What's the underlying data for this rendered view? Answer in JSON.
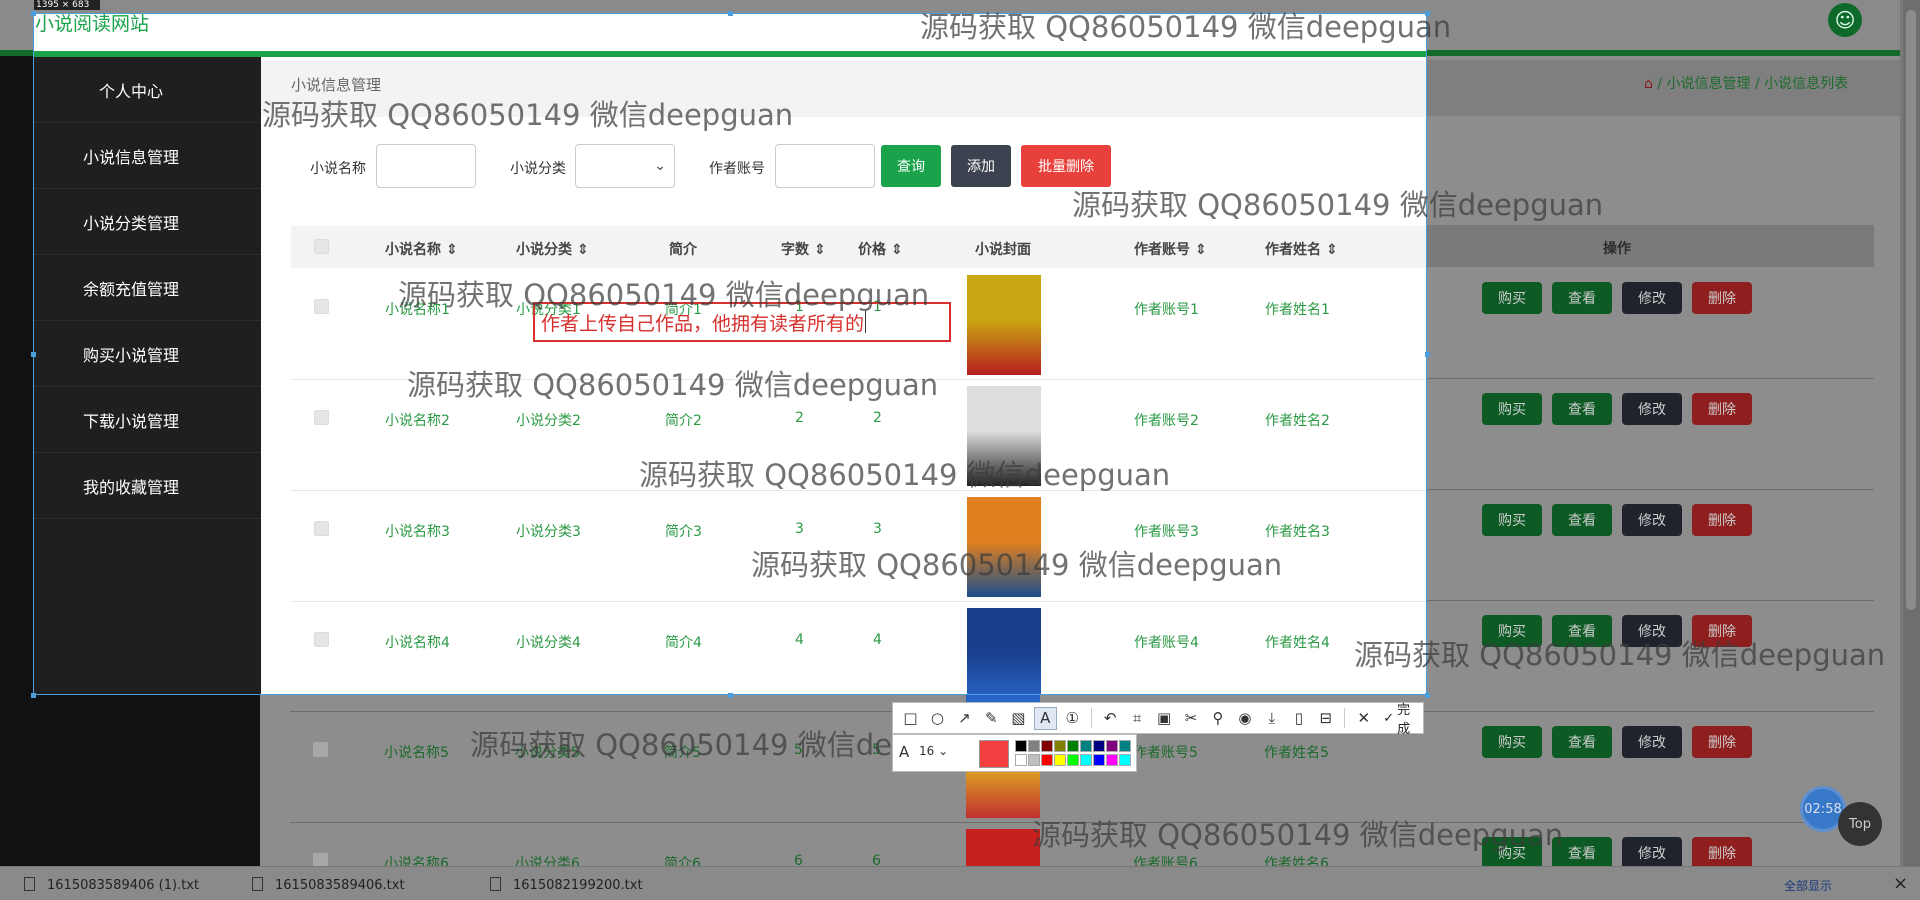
{
  "site": {
    "title": "小说阅读网站"
  },
  "capture_size": "1395 × 683",
  "sidebar": {
    "items": [
      {
        "label": "个人中心"
      },
      {
        "label": "小说信息管理"
      },
      {
        "label": "小说分类管理"
      },
      {
        "label": "余额充值管理"
      },
      {
        "label": "购买小说管理"
      },
      {
        "label": "下载小说管理"
      },
      {
        "label": "我的收藏管理"
      }
    ]
  },
  "breadcrumb": {
    "title": "小说信息管理",
    "home_icon": "home-icon",
    "path": "小说信息管理 / 小说信息列表"
  },
  "search": {
    "name_label": "小说名称",
    "name_value": "",
    "category_label": "小说分类",
    "category_value": "",
    "author_label": "作者账号",
    "author_value": "",
    "query_button": "查询",
    "add_button": "添加",
    "batch_delete_button": "批量删除"
  },
  "table": {
    "headers": {
      "name": "小说名称",
      "category": "小说分类",
      "intro": "简介",
      "words": "字数",
      "price": "价格",
      "cover": "小说封面",
      "author_account": "作者账号",
      "author_name": "作者姓名",
      "actions": "操作"
    },
    "rows": [
      {
        "name": "小说名称1",
        "category": "小说分类1",
        "intro": "简介1",
        "words": "1",
        "price": "1",
        "author_account": "作者账号1",
        "author_name": "作者姓名1"
      },
      {
        "name": "小说名称2",
        "category": "小说分类2",
        "intro": "简介2",
        "words": "2",
        "price": "2",
        "author_account": "作者账号2",
        "author_name": "作者姓名2"
      },
      {
        "name": "小说名称3",
        "category": "小说分类3",
        "intro": "简介3",
        "words": "3",
        "price": "3",
        "author_account": "作者账号3",
        "author_name": "作者姓名3"
      },
      {
        "name": "小说名称4",
        "category": "小说分类4",
        "intro": "简介4",
        "words": "4",
        "price": "4",
        "author_account": "作者账号4",
        "author_name": "作者姓名4"
      },
      {
        "name": "小说名称5",
        "category": "小说分类5",
        "intro": "简介5",
        "words": "5",
        "price": "5",
        "author_account": "作者账号5",
        "author_name": "作者姓名5"
      },
      {
        "name": "小说名称6",
        "category": "小说分类6",
        "intro": "简介6",
        "words": "6",
        "price": "6",
        "author_account": "作者账号6",
        "author_name": "作者姓名6"
      }
    ],
    "action_labels": {
      "buy": "购买",
      "view": "查看",
      "edit": "修改",
      "delete": "删除"
    }
  },
  "annotation_text": "作者上传自己作品，他拥有读者所有的",
  "watermark": "源码获取 QQ86050149 微信deepguan",
  "toolbar": {
    "done_label": "完成",
    "font_size": "16",
    "current_color": "#f24040",
    "palette": [
      "#000000",
      "#808080",
      "#800000",
      "#808000",
      "#008000",
      "#008080",
      "#000080",
      "#800080",
      "#008080",
      "#ffffff",
      "#c0c0c0",
      "#ff0000",
      "#ffff00",
      "#00ff00",
      "#00ffff",
      "#0000ff",
      "#ff00ff",
      "#00ffff"
    ]
  },
  "downloads": {
    "files": [
      "1615083589406 (1).txt",
      "1615083589406.txt",
      "1615082199200.txt"
    ],
    "show_all": "全部显示"
  },
  "clock": "02:58",
  "top_button": "Top"
}
